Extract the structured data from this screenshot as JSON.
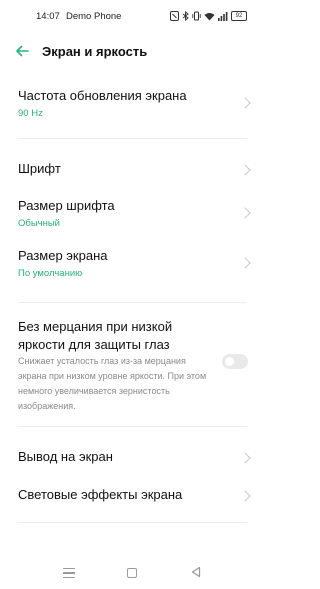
{
  "status_bar": {
    "time": "14:07",
    "carrier": "Demo Phone",
    "battery": "92"
  },
  "header": {
    "title": "Экран и яркость"
  },
  "items": {
    "refresh_rate": {
      "title": "Частота обновления экрана",
      "value": "90 Hz"
    },
    "font": {
      "title": "Шрифт"
    },
    "font_size": {
      "title": "Размер шрифта",
      "value": "Обычный"
    },
    "screen_size": {
      "title": "Размер экрана",
      "value": "По умолчанию"
    },
    "flicker_free": {
      "title": "Без мерцания при низкой яркости для защиты глаз",
      "description": "Снижает усталость глаз из-за мерцания экрана при низком уровне яркости. При этом немного увеличивается зернистость изображения.",
      "enabled": false
    },
    "screen_output": {
      "title": "Вывод на экран"
    },
    "light_effects": {
      "title": "Световые эффекты экрана"
    }
  },
  "colors": {
    "accent": "#27b27a",
    "text": "#111111",
    "secondary_text": "#8a8a8a"
  },
  "icons": {
    "back": "arrow-left-icon",
    "chevron": "chevron-right-icon",
    "nav_menu": "menu-icon",
    "nav_home": "home-square-icon",
    "nav_back": "triangle-back-icon"
  }
}
